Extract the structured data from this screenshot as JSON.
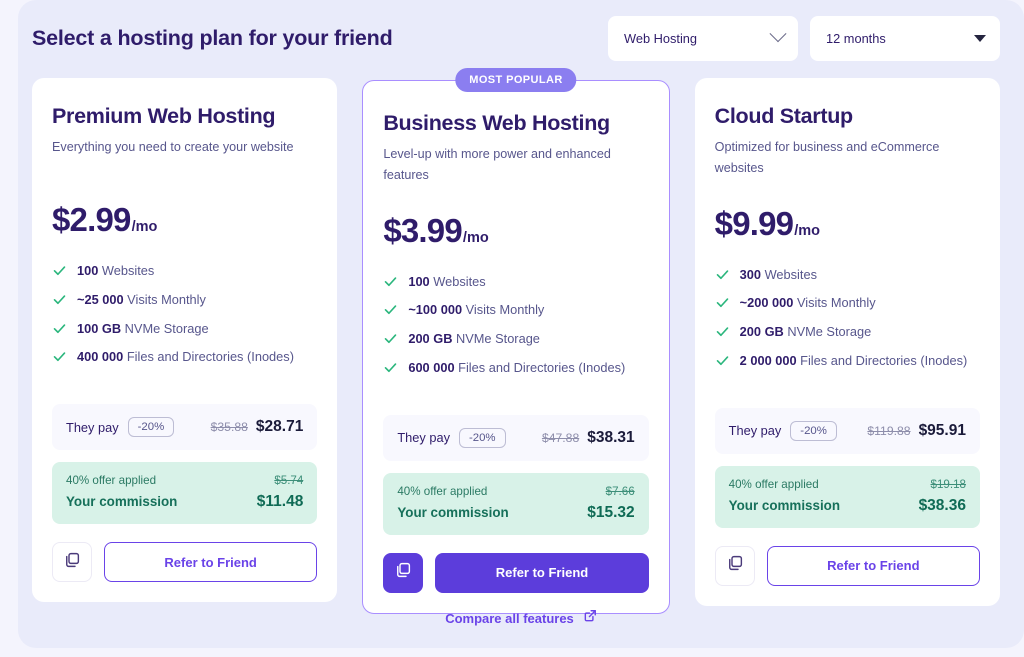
{
  "header": {
    "title": "Select a hosting plan for your friend",
    "product_select": {
      "value": "Web Hosting",
      "icon": "chevron-down-icon"
    },
    "period_select": {
      "value": "12 months",
      "icon": "caret-down-icon"
    }
  },
  "badge_label": "MOST POPULAR",
  "labels": {
    "they_pay": "They pay",
    "discount": "-20%",
    "offer_applied": "40% offer applied",
    "your_commission": "Your commission",
    "refer": "Refer to Friend",
    "copy_icon": "copy-icon",
    "check_icon": "check-icon"
  },
  "plans": [
    {
      "name": "Premium Web Hosting",
      "description": "Everything you need to create your website",
      "price": "$2.99",
      "period": "/mo",
      "featured": false,
      "features": [
        {
          "value": "100",
          "text": " Websites"
        },
        {
          "value": "~25 000",
          "text": " Visits Monthly"
        },
        {
          "value": "100 GB",
          "text": " NVMe Storage"
        },
        {
          "value": "400 000",
          "text": " Files and Directories (Inodes)"
        }
      ],
      "they_pay_old": "$35.88",
      "they_pay_new": "$28.71",
      "commission_old": "$5.74",
      "commission_new": "$11.48"
    },
    {
      "name": "Business Web Hosting",
      "description": "Level-up with more power and enhanced features",
      "price": "$3.99",
      "period": "/mo",
      "featured": true,
      "features": [
        {
          "value": "100",
          "text": " Websites"
        },
        {
          "value": "~100 000",
          "text": " Visits Monthly"
        },
        {
          "value": "200 GB",
          "text": " NVMe Storage"
        },
        {
          "value": "600 000",
          "text": " Files and Directories (Inodes)"
        }
      ],
      "they_pay_old": "$47.88",
      "they_pay_new": "$38.31",
      "commission_old": "$7.66",
      "commission_new": "$15.32"
    },
    {
      "name": "Cloud Startup",
      "description": "Optimized for business and eCommerce websites",
      "price": "$9.99",
      "period": "/mo",
      "featured": false,
      "features": [
        {
          "value": "300",
          "text": " Websites"
        },
        {
          "value": "~200 000",
          "text": " Visits Monthly"
        },
        {
          "value": "200 GB",
          "text": " NVMe Storage"
        },
        {
          "value": "2 000 000",
          "text": " Files and Directories (Inodes)"
        }
      ],
      "they_pay_old": "$119.88",
      "they_pay_new": "$95.91",
      "commission_old": "$19.18",
      "commission_new": "$38.36"
    }
  ],
  "footer": {
    "compare_label": "Compare all features",
    "icon": "external-link-icon"
  },
  "colors": {
    "page_bg": "#f4f4fd",
    "panel_bg": "#e9ebfa",
    "primary": "#6a43e8",
    "primary_solid": "#5c3ddb",
    "badge": "#8b7ef0",
    "heading": "#2f1c6a",
    "commission_bg": "#d8f2e8",
    "commission_text": "#0f6b55",
    "check": "#2bb67d"
  }
}
